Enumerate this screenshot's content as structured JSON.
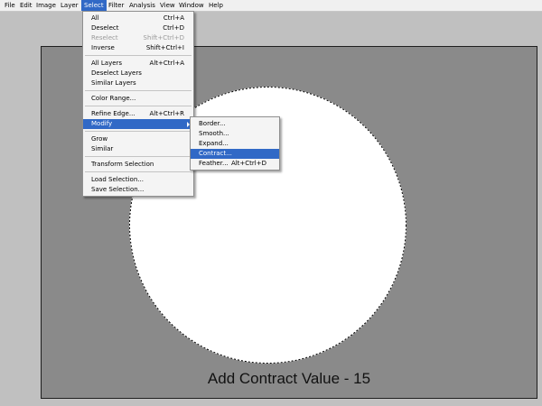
{
  "menubar": {
    "items": [
      {
        "label": "File"
      },
      {
        "label": "Edit"
      },
      {
        "label": "Image"
      },
      {
        "label": "Layer"
      },
      {
        "label": "Select"
      },
      {
        "label": "Filter"
      },
      {
        "label": "Analysis"
      },
      {
        "label": "View"
      },
      {
        "label": "Window"
      },
      {
        "label": "Help"
      }
    ],
    "active": "Select"
  },
  "select_menu": {
    "items": [
      {
        "label": "All",
        "shortcut": "Ctrl+A"
      },
      {
        "label": "Deselect",
        "shortcut": "Ctrl+D"
      },
      {
        "label": "Reselect",
        "shortcut": "Shift+Ctrl+D",
        "disabled": true
      },
      {
        "label": "Inverse",
        "shortcut": "Shift+Ctrl+I"
      },
      {
        "label": "All Layers",
        "shortcut": "Alt+Ctrl+A"
      },
      {
        "label": "Deselect Layers",
        "shortcut": ""
      },
      {
        "label": "Similar Layers",
        "shortcut": ""
      },
      {
        "label": "Color Range...",
        "shortcut": ""
      },
      {
        "label": "Refine Edge...",
        "shortcut": "Alt+Ctrl+R"
      },
      {
        "label": "Modify",
        "shortcut": "",
        "submenu": true,
        "highlighted": true
      },
      {
        "label": "Grow",
        "shortcut": ""
      },
      {
        "label": "Similar",
        "shortcut": ""
      },
      {
        "label": "Transform Selection",
        "shortcut": ""
      },
      {
        "label": "Load Selection...",
        "shortcut": ""
      },
      {
        "label": "Save Selection...",
        "shortcut": ""
      }
    ]
  },
  "modify_menu": {
    "items": [
      {
        "label": "Border...",
        "shortcut": ""
      },
      {
        "label": "Smooth...",
        "shortcut": ""
      },
      {
        "label": "Expand...",
        "shortcut": ""
      },
      {
        "label": "Contract...",
        "shortcut": "",
        "highlighted": true
      },
      {
        "label": "Feather...",
        "shortcut": "Alt+Ctrl+D"
      }
    ]
  },
  "canvas": {
    "caption": "Add Contract Value - 15",
    "background_color": "#8a8a8a",
    "selection_fill": "#ffffff",
    "selection_shape": "circle-marching-ants"
  },
  "colors": {
    "highlight": "#3169c6",
    "app_background": "#c0c0c0"
  }
}
